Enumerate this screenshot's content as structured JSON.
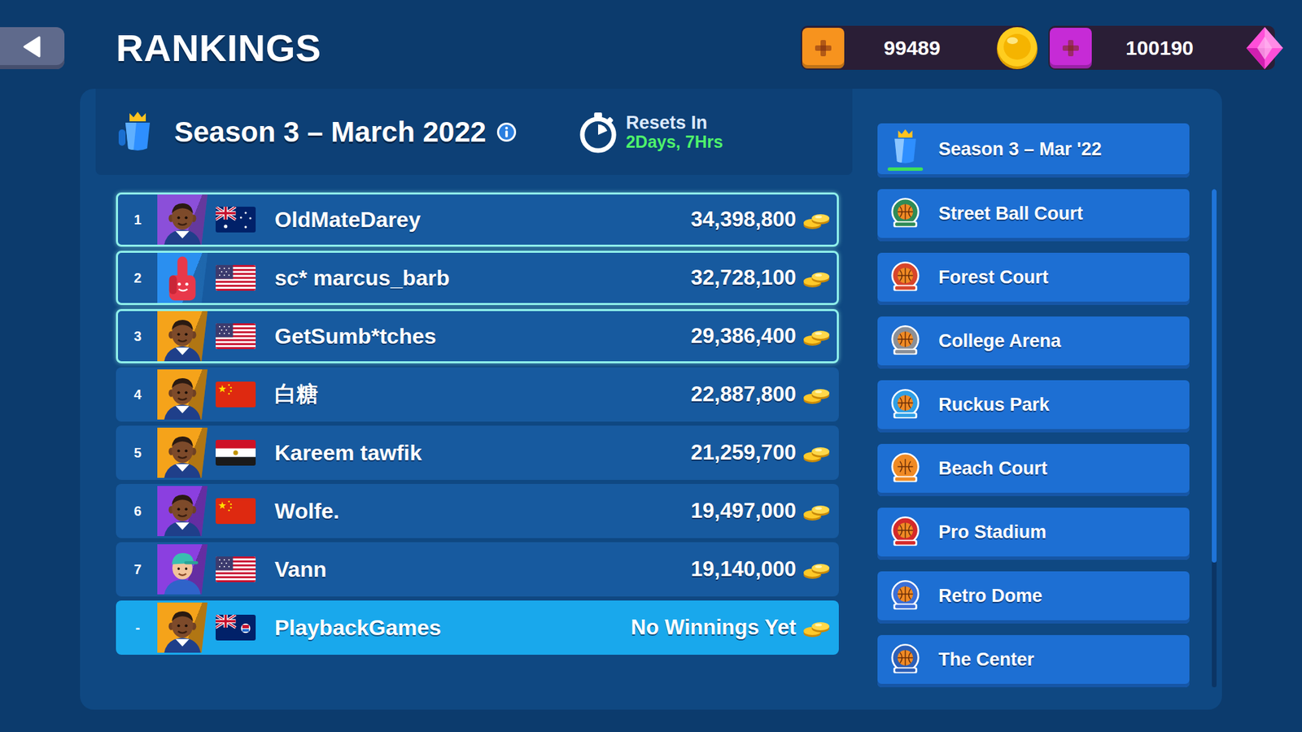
{
  "page": {
    "title": "RANKINGS"
  },
  "currencies": [
    {
      "kind": "coins",
      "amount": "99489",
      "color": "#f7931e"
    },
    {
      "kind": "gems",
      "amount": "100190",
      "color": "#c62bd6"
    }
  ],
  "season": {
    "title": "Season 3 – March 2022",
    "reset_label": "Resets In",
    "reset_time": "2Days, 7Hrs"
  },
  "rankings": [
    {
      "rank": "1",
      "name": "OldMateDarey",
      "score": "34,398,800",
      "flag": "au",
      "avatar": "player",
      "color": "#8b4fd9",
      "highlighted": true,
      "current_player": false
    },
    {
      "rank": "2",
      "name": "sc* marcus_barb",
      "score": "32,728,100",
      "flag": "us",
      "avatar": "foam-finger",
      "color": "#2a8ff0",
      "highlighted": true,
      "current_player": false
    },
    {
      "rank": "3",
      "name": "GetSumb*tches",
      "score": "29,386,400",
      "flag": "us",
      "avatar": "player",
      "color": "#f5a31a",
      "highlighted": true,
      "current_player": false
    },
    {
      "rank": "4",
      "name": "白糖",
      "score": "22,887,800",
      "flag": "cn",
      "avatar": "player",
      "color": "#f5a31a",
      "highlighted": false,
      "current_player": false
    },
    {
      "rank": "5",
      "name": "Kareem tawfik",
      "score": "21,259,700",
      "flag": "eg",
      "avatar": "player",
      "color": "#f5a31a",
      "highlighted": false,
      "current_player": false
    },
    {
      "rank": "6",
      "name": "Wolfe.",
      "score": "19,497,000",
      "flag": "cn",
      "avatar": "player",
      "color": "#8b3fe0",
      "highlighted": false,
      "current_player": false
    },
    {
      "rank": "7",
      "name": "Vann",
      "score": "19,140,000",
      "flag": "us",
      "avatar": "cap",
      "color": "#8b3fe0",
      "highlighted": false,
      "current_player": false
    },
    {
      "rank": "-",
      "name": "PlaybackGames",
      "score": "No Winnings Yet",
      "flag": "ky",
      "avatar": "player",
      "color": "#f5a31a",
      "highlighted": false,
      "current_player": true
    }
  ],
  "sidebar": {
    "season_tab": {
      "label": "Season 3 – Mar '22",
      "selected": true
    },
    "arenas": [
      {
        "label": "Street Ball Court",
        "selected": false,
        "color": "#2e8b57"
      },
      {
        "label": "Forest Court",
        "selected": false,
        "color": "#d8452b"
      },
      {
        "label": "College Arena",
        "selected": false,
        "color": "#8a8f98"
      },
      {
        "label": "Ruckus Park",
        "selected": false,
        "color": "#2f9fe6"
      },
      {
        "label": "Beach Court",
        "selected": false,
        "color": "#f08a24"
      },
      {
        "label": "Pro Stadium",
        "selected": false,
        "color": "#d42a2a"
      },
      {
        "label": "Retro Dome",
        "selected": false,
        "color": "#3a6fd8"
      },
      {
        "label": "The Center",
        "selected": false,
        "color": "#2b5fb8"
      }
    ],
    "scroll_level": 0.75
  }
}
